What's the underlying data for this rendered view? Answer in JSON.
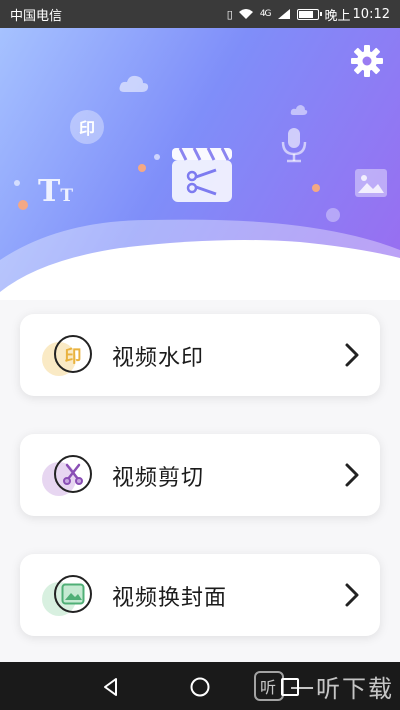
{
  "status_bar": {
    "carrier": "中国电信",
    "signal": "4G",
    "time_prefix": "晚上",
    "time": "10:12"
  },
  "header": {
    "settings_icon": "gear-icon",
    "illustration": {
      "center_icon": "clapperboard-scissors-icon",
      "decor_icons": [
        "stamp-icon",
        "cloud-icon",
        "text-size-icon",
        "microphone-icon",
        "image-icon"
      ],
      "deco_letters": {
        "text_size_big": "T",
        "text_size_small": "T",
        "stamp": "印"
      }
    }
  },
  "menu": {
    "items": [
      {
        "label": "视频水印",
        "icon": "stamp-icon",
        "icon_text": "印",
        "accent": "#f2c35a"
      },
      {
        "label": "视频剪切",
        "icon": "scissors-icon",
        "accent": "#b98ad8"
      },
      {
        "label": "视频换封面",
        "icon": "image-icon",
        "accent": "#8fd4a6"
      }
    ]
  },
  "nav_bar": {
    "buttons": [
      "back-icon",
      "home-icon",
      "recents-icon"
    ],
    "watermark_logo": "听",
    "watermark_text": "一听下载"
  },
  "colors": {
    "hero_gradient_start": "#a6c2ff",
    "hero_gradient_end": "#9a6cf0",
    "chevron": "#222222"
  }
}
